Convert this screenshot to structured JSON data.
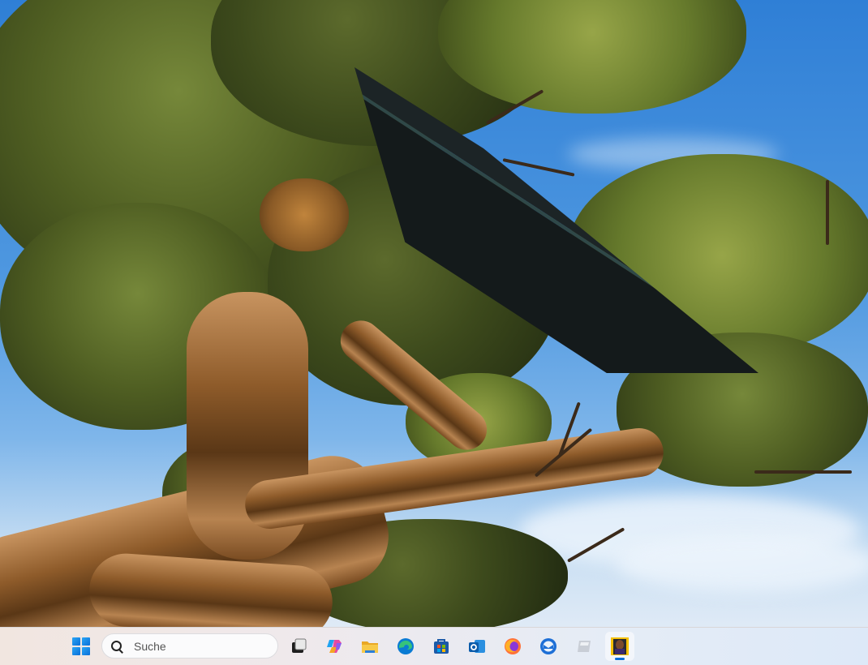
{
  "desktop": {
    "wallpaper": "juniper-tree-against-blue-sky"
  },
  "taskbar": {
    "start_icon": "windows-logo-icon",
    "search": {
      "placeholder": "Suche",
      "icon": "search-icon"
    },
    "apps": [
      {
        "name": "task-view",
        "icon": "task-view-icon"
      },
      {
        "name": "copilot",
        "icon": "copilot-icon"
      },
      {
        "name": "file-explorer",
        "icon": "folder-icon"
      },
      {
        "name": "edge",
        "icon": "edge-icon"
      },
      {
        "name": "microsoft-store",
        "icon": "store-icon"
      },
      {
        "name": "outlook",
        "icon": "outlook-icon"
      },
      {
        "name": "firefox",
        "icon": "firefox-icon"
      },
      {
        "name": "thunderbird",
        "icon": "thunderbird-icon"
      },
      {
        "name": "generic-app",
        "icon": "app-icon"
      },
      {
        "name": "photo-viewer",
        "icon": "photo-icon",
        "active": true
      }
    ],
    "accent": "#0a6fd8"
  }
}
